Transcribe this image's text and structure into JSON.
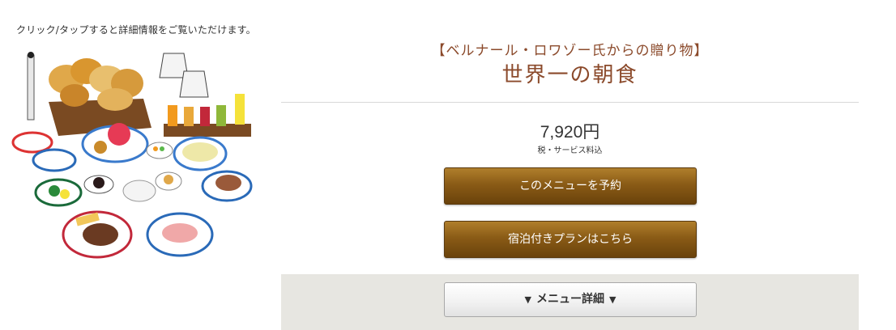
{
  "hint_text": "クリック/タップすると詳細情報をご覧いただけます。",
  "menu": {
    "subtitle": "【ベルナール・ロワゾー氏からの贈り物】",
    "title": "世界一の朝食",
    "price": "7,920円",
    "tax_note": "税・サービス料込"
  },
  "buttons": {
    "reserve": "このメニューを予約",
    "stay_plan": "宿泊付きプランはこちら",
    "details": "メニュー詳細",
    "details_left_icon": "▼",
    "details_right_icon": "▼"
  },
  "colors": {
    "title": "#8b4a2b",
    "button_brown": "#8a5b16",
    "detail_band": "#e7e6e1"
  }
}
